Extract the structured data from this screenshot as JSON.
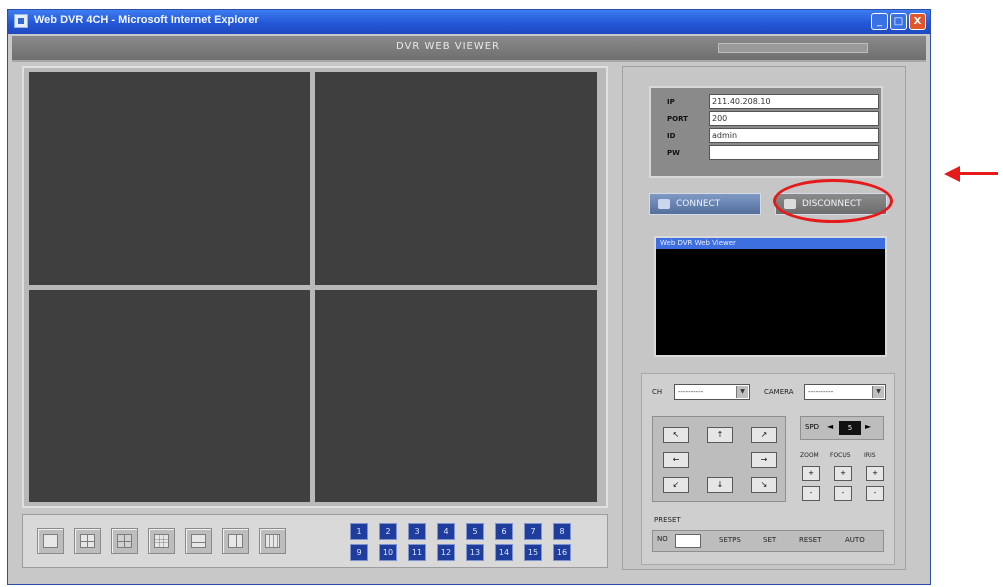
{
  "window": {
    "title": "Web DVR 4CH - Microsoft Internet Explorer",
    "controls": [
      "_",
      "□",
      "X"
    ]
  },
  "app": {
    "title": "DVR WEB VIEWER"
  },
  "login": {
    "ip_label": "IP",
    "port_label": "PORT",
    "id_label": "ID",
    "pw_label": "PW",
    "ip_value": "211.40.208.10",
    "port_value": "200",
    "id_value": "admin",
    "pw_value": ""
  },
  "buttons": {
    "connect": "CONNECT",
    "disconnect": "DISCONNECT"
  },
  "status": {
    "selected_line": "Web DVR Web Viewer"
  },
  "ptz": {
    "ch_label": "CH",
    "ch_value": "----------",
    "camera_label": "CAMERA",
    "camera_value": "----------",
    "speed_label": "SPD",
    "speed_value": "5",
    "zoom_label": "ZOOM",
    "focus_label": "FOCUS",
    "iris_label": "IRIS",
    "preset_label": "PRESET",
    "preset_no": "NO",
    "preset_buttons": [
      "SETPS",
      "SET",
      "RESET",
      "AUTO"
    ]
  },
  "channels_row1": [
    "1",
    "2",
    "3",
    "4",
    "5",
    "6",
    "7",
    "8"
  ],
  "channels_row2": [
    "9",
    "10",
    "11",
    "12",
    "13",
    "14",
    "15",
    "16"
  ],
  "icons": {
    "layout_buttons": [
      "single-view",
      "quad-view",
      "split-view",
      "grid-9-view",
      "grid-16-view",
      "sequence-view",
      "full-screen"
    ],
    "annotation": "red-arrow"
  },
  "colors": {
    "accent_blue": "#2457d6",
    "highlight_red": "#e51b1b",
    "video_bg": "#3f3f3f"
  }
}
